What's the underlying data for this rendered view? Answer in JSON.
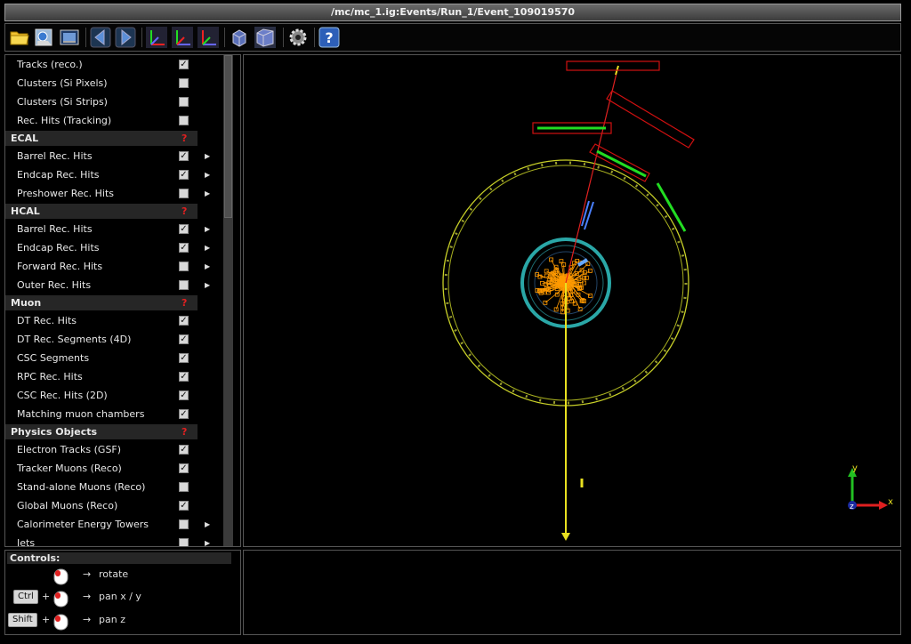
{
  "window": {
    "title": "/mc/mc_1.ig:Events/Run_1/Event_109019570"
  },
  "toolbar": {
    "buttons": [
      {
        "name": "open-file",
        "icon": "folder-icon"
      },
      {
        "name": "open-url",
        "icon": "network-folder-icon"
      },
      {
        "name": "screenshot",
        "icon": "camera-icon"
      },
      {
        "name": "previous-event",
        "icon": "arrow-left-icon"
      },
      {
        "name": "next-event",
        "icon": "arrow-right-icon"
      },
      {
        "name": "view-xy",
        "icon": "axes-xy-icon"
      },
      {
        "name": "view-yz",
        "icon": "axes-yz-icon"
      },
      {
        "name": "view-xz",
        "icon": "axes-xz-icon"
      },
      {
        "name": "orthographic",
        "icon": "cube-ortho-icon"
      },
      {
        "name": "perspective",
        "icon": "cube-perspective-icon"
      },
      {
        "name": "settings",
        "icon": "gear-icon"
      },
      {
        "name": "help",
        "icon": "question-icon"
      }
    ]
  },
  "sidebar": {
    "rows": [
      {
        "type": "item",
        "label": "Tracks (reco.)",
        "checked": true,
        "arrow": false
      },
      {
        "type": "item",
        "label": "Clusters (Si Pixels)",
        "checked": false,
        "arrow": false
      },
      {
        "type": "item",
        "label": "Clusters (Si Strips)",
        "checked": false,
        "arrow": false
      },
      {
        "type": "item",
        "label": "Rec. Hits (Tracking)",
        "checked": false,
        "arrow": false
      },
      {
        "type": "section",
        "label": "ECAL",
        "help": "?"
      },
      {
        "type": "item",
        "label": "Barrel Rec. Hits",
        "checked": true,
        "arrow": true
      },
      {
        "type": "item",
        "label": "Endcap Rec. Hits",
        "checked": true,
        "arrow": true
      },
      {
        "type": "item",
        "label": "Preshower Rec. Hits",
        "checked": false,
        "arrow": true
      },
      {
        "type": "section",
        "label": "HCAL",
        "help": "?"
      },
      {
        "type": "item",
        "label": "Barrel Rec. Hits",
        "checked": true,
        "arrow": true
      },
      {
        "type": "item",
        "label": "Endcap Rec. Hits",
        "checked": true,
        "arrow": true
      },
      {
        "type": "item",
        "label": "Forward Rec. Hits",
        "checked": false,
        "arrow": true
      },
      {
        "type": "item",
        "label": "Outer Rec. Hits",
        "checked": false,
        "arrow": true
      },
      {
        "type": "section",
        "label": "Muon",
        "help": "?"
      },
      {
        "type": "item",
        "label": "DT Rec. Hits",
        "checked": true,
        "arrow": false
      },
      {
        "type": "item",
        "label": "DT Rec. Segments (4D)",
        "checked": true,
        "arrow": false
      },
      {
        "type": "item",
        "label": "CSC Segments",
        "checked": true,
        "arrow": false
      },
      {
        "type": "item",
        "label": "RPC Rec. Hits",
        "checked": true,
        "arrow": false
      },
      {
        "type": "item",
        "label": "CSC Rec. Hits (2D)",
        "checked": true,
        "arrow": false
      },
      {
        "type": "item",
        "label": "Matching muon chambers",
        "checked": true,
        "arrow": false
      },
      {
        "type": "section",
        "label": "Physics Objects",
        "help": "?"
      },
      {
        "type": "item",
        "label": "Electron Tracks (GSF)",
        "checked": true,
        "arrow": false
      },
      {
        "type": "item",
        "label": "Tracker Muons (Reco)",
        "checked": true,
        "arrow": false
      },
      {
        "type": "item",
        "label": "Stand-alone Muons (Reco)",
        "checked": false,
        "arrow": false
      },
      {
        "type": "item",
        "label": "Global Muons (Reco)",
        "checked": true,
        "arrow": false
      },
      {
        "type": "item",
        "label": "Calorimeter Energy Towers",
        "checked": false,
        "arrow": true
      },
      {
        "type": "item",
        "label": "Jets",
        "checked": false,
        "arrow": true
      }
    ]
  },
  "controls": {
    "title": "Controls:",
    "rows": [
      {
        "keys": [],
        "arrow": "→",
        "action": "rotate"
      },
      {
        "keys": [
          "Ctrl"
        ],
        "plus": "+",
        "arrow": "→",
        "action": "pan x / y"
      },
      {
        "keys": [
          "Shift"
        ],
        "plus": "+",
        "arrow": "→",
        "action": "pan z"
      }
    ]
  },
  "view": {
    "axes": {
      "x": "x",
      "y": "y",
      "z": "z"
    },
    "colors": {
      "muon_system": "#c8d028",
      "tracker": "#2aa7a7",
      "hits": "#ff9a00",
      "muon_track": "#e8e020",
      "dt_chamber": "#d01010",
      "segment": "#22dd22",
      "electron": "#4a80ff"
    }
  }
}
